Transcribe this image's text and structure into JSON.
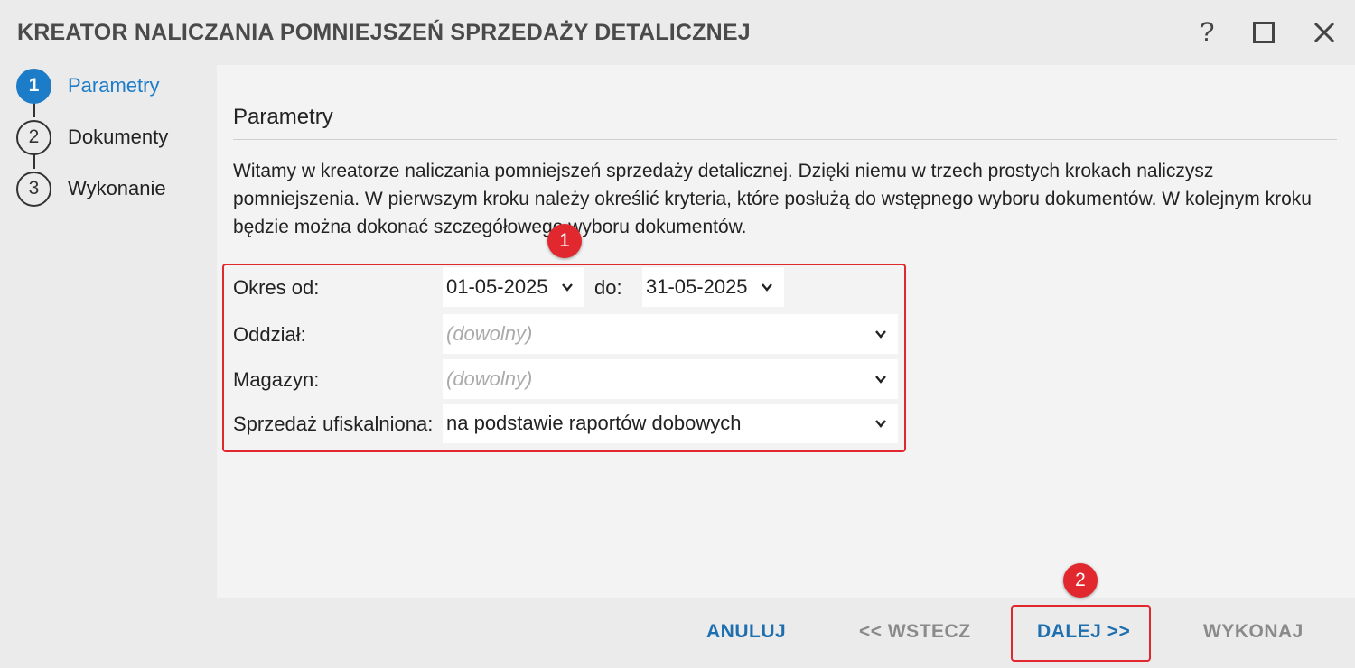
{
  "window": {
    "title": "KREATOR NALICZANIA POMNIEJSZEŃ SPRZEDAŻY DETALICZNEJ",
    "help_label": "?"
  },
  "steps": [
    {
      "number": "1",
      "label": "Parametry",
      "active": true
    },
    {
      "number": "2",
      "label": "Dokumenty",
      "active": false
    },
    {
      "number": "3",
      "label": "Wykonanie",
      "active": false
    }
  ],
  "main": {
    "section_title": "Parametry",
    "intro_text": "Witamy w kreatorze naliczania pomniejszeń sprzedaży detalicznej. Dzięki niemu w trzech prostych krokach naliczysz pomniejszenia. W pierwszym kroku należy określić kryteria, które posłużą do wstępnego wyboru dokumentów. W kolejnym kroku będzie można dokonać szczegółowego wyboru dokumentów."
  },
  "form": {
    "okres_label": "Okres od:",
    "date_from": "01-05-2025",
    "do_label": "do:",
    "date_to": "31-05-2025",
    "oddzial_label": "Oddział:",
    "oddzial_value": "(dowolny)",
    "magazyn_label": "Magazyn:",
    "magazyn_value": "(dowolny)",
    "sprzedaz_label": "Sprzedaż ufiskalniona:",
    "sprzedaz_value": "na podstawie raportów dobowych"
  },
  "annotations": {
    "badge_1": "1",
    "badge_2": "2",
    "highlight_color": "#e0282e"
  },
  "footer": {
    "anuluj": "ANULUJ",
    "wstecz": "<< WSTECZ",
    "dalej": "DALEJ >>",
    "wykonaj": "WYKONAJ"
  },
  "colors": {
    "accent": "#1d7cc8",
    "disabled": "#8a8a8a"
  }
}
